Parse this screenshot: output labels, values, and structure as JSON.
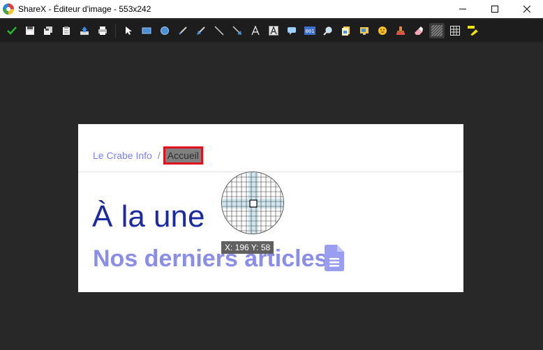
{
  "window": {
    "title": "ShareX - Éditeur d'image - 553x242"
  },
  "toolbar": {
    "buttons": [
      {
        "name": "confirm-icon",
        "group": 1
      },
      {
        "name": "save-icon",
        "group": 1
      },
      {
        "name": "save-as-icon",
        "group": 1
      },
      {
        "name": "copy-icon",
        "group": 1
      },
      {
        "name": "upload-icon",
        "group": 1
      },
      {
        "name": "print-icon",
        "group": 1
      },
      {
        "name": "select-cursor-icon",
        "group": 2
      },
      {
        "name": "rectangle-icon",
        "group": 2
      },
      {
        "name": "ellipse-icon",
        "group": 2
      },
      {
        "name": "freehand-icon",
        "group": 2
      },
      {
        "name": "freehand-arrow-icon",
        "group": 2
      },
      {
        "name": "line-icon",
        "group": 2
      },
      {
        "name": "arrow-icon",
        "group": 2
      },
      {
        "name": "text-outline-icon",
        "group": 2
      },
      {
        "name": "text-background-icon",
        "group": 2
      },
      {
        "name": "speech-balloon-icon",
        "group": 2
      },
      {
        "name": "step-number-icon",
        "group": 2
      },
      {
        "name": "magnify-icon",
        "group": 2
      },
      {
        "name": "image-file-icon",
        "group": 2
      },
      {
        "name": "image-screen-icon",
        "group": 2
      },
      {
        "name": "emoji-icon",
        "group": 2
      },
      {
        "name": "cursor-sticker-icon",
        "group": 2
      },
      {
        "name": "eraser-icon",
        "group": 2
      },
      {
        "name": "blur-icon",
        "group": 2
      },
      {
        "name": "pixelate-icon",
        "group": 2
      },
      {
        "name": "highlight-icon",
        "group": 2
      }
    ],
    "step_number_text": "001"
  },
  "canvas": {
    "breadcrumb_link": "Le Crabe Info",
    "breadcrumb_separator": "/",
    "breadcrumb_current": "Accueil",
    "headline": "À la une",
    "subheadline": "Nos derniers articles",
    "colors": {
      "link": "#7b82e3",
      "headline": "#1b2aa0",
      "subheadline": "#8a8ee8",
      "highlight_border": "#e0101c"
    }
  },
  "cursor_info": {
    "coordinates": "X: 196 Y: 58"
  }
}
